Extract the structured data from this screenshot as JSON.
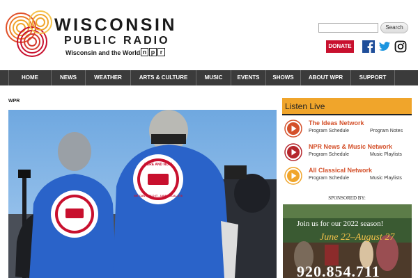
{
  "header": {
    "title": "WISCONSIN",
    "subtitle": "PUBLIC RADIO",
    "tagline": "Wisconsin and the World.",
    "npr_letters": [
      "n",
      "p",
      "r"
    ],
    "search_placeholder": "",
    "search_button": "Search",
    "donate_button": "DONATE",
    "social_icons": [
      "facebook-icon",
      "twitter-icon",
      "instagram-icon"
    ]
  },
  "nav": {
    "items": [
      {
        "label": "HOME"
      },
      {
        "label": "NEWS"
      },
      {
        "label": "WEATHER"
      },
      {
        "label": "ARTS & CULTURE"
      },
      {
        "label": "MUSIC"
      },
      {
        "label": "EVENTS"
      },
      {
        "label": "SHOWS"
      },
      {
        "label": "ABOUT WPR"
      },
      {
        "label": "SUPPORT"
      }
    ]
  },
  "main": {
    "breadcrumb": "WPR",
    "hero_shirt_text": "HERE AND NOW",
    "hero_shirt_subtext": "WE CAN BUILD IT - UAW LOCAL 578"
  },
  "sidebar": {
    "listen_title": "Listen Live",
    "stations": [
      {
        "name": "The Ideas Network",
        "link_a": "Program Schedule",
        "link_b": "Program Notes",
        "color": "#d4502a"
      },
      {
        "name": "NPR News & Music Network",
        "link_a": "Program Schedule",
        "link_b": "Music Playlists",
        "color": "#b5262c"
      },
      {
        "name": "All Classical Network",
        "link_a": "Program Schedule",
        "link_b": "Music Playlists",
        "color": "#f0a52b"
      }
    ],
    "sponsored_label": "SPONSORED BY:",
    "ad": {
      "line1": "Join us for our 2022 season!",
      "line2": "June 22–August 27",
      "line3": "920.854.711"
    }
  },
  "colors": {
    "nav_bg": "#3b3b3b",
    "accent_orange": "#f0a52b",
    "donate_red": "#c8102e",
    "station_link": "#d4502a"
  }
}
